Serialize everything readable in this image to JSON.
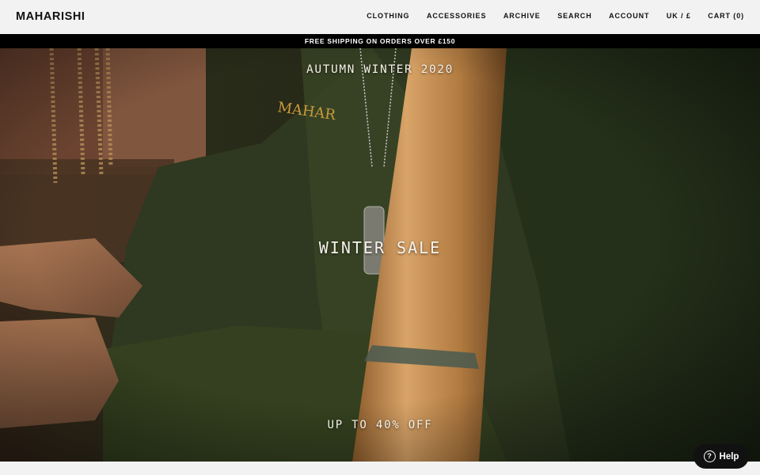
{
  "header": {
    "logo": "MAHARISHI",
    "nav": [
      {
        "label": "CLOTHING"
      },
      {
        "label": "ACCESSORIES"
      },
      {
        "label": "ARCHIVE"
      },
      {
        "label": "SEARCH"
      },
      {
        "label": "ACCOUNT"
      },
      {
        "label": "UK / £"
      },
      {
        "label": "CART (0)"
      }
    ]
  },
  "announcement": "FREE SHIPPING ON ORDERS OVER £150",
  "hero": {
    "season": "AUTUMN WINTER 2020",
    "title": "WINTER SALE",
    "subtitle": "UP TO 40% OFF"
  },
  "help_widget": {
    "icon": "question-icon",
    "glyph": "?",
    "label": "Help"
  }
}
